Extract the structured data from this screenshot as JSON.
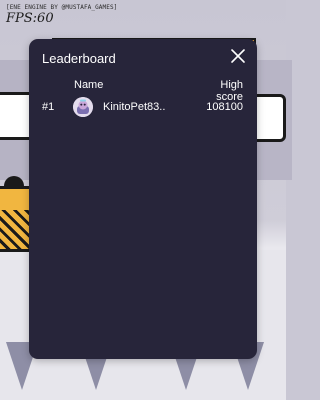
{
  "hud": {
    "engine_credit": "[ENE ENGINE BY @MUSTAFA_GAMES]",
    "fps": "FPS:60"
  },
  "leaderboard": {
    "title": "Leaderboard",
    "columns": {
      "name": "Name",
      "score": "High score"
    },
    "rows": [
      {
        "rank": "#1",
        "player": "KinitoPet83..",
        "score": "108100",
        "avatar_icon": "player-avatar-icon"
      }
    ],
    "close_icon": "close-icon"
  },
  "colors": {
    "modal_bg": "#27253a",
    "text": "#ffffff",
    "accent_orange": "#f3a43a"
  }
}
